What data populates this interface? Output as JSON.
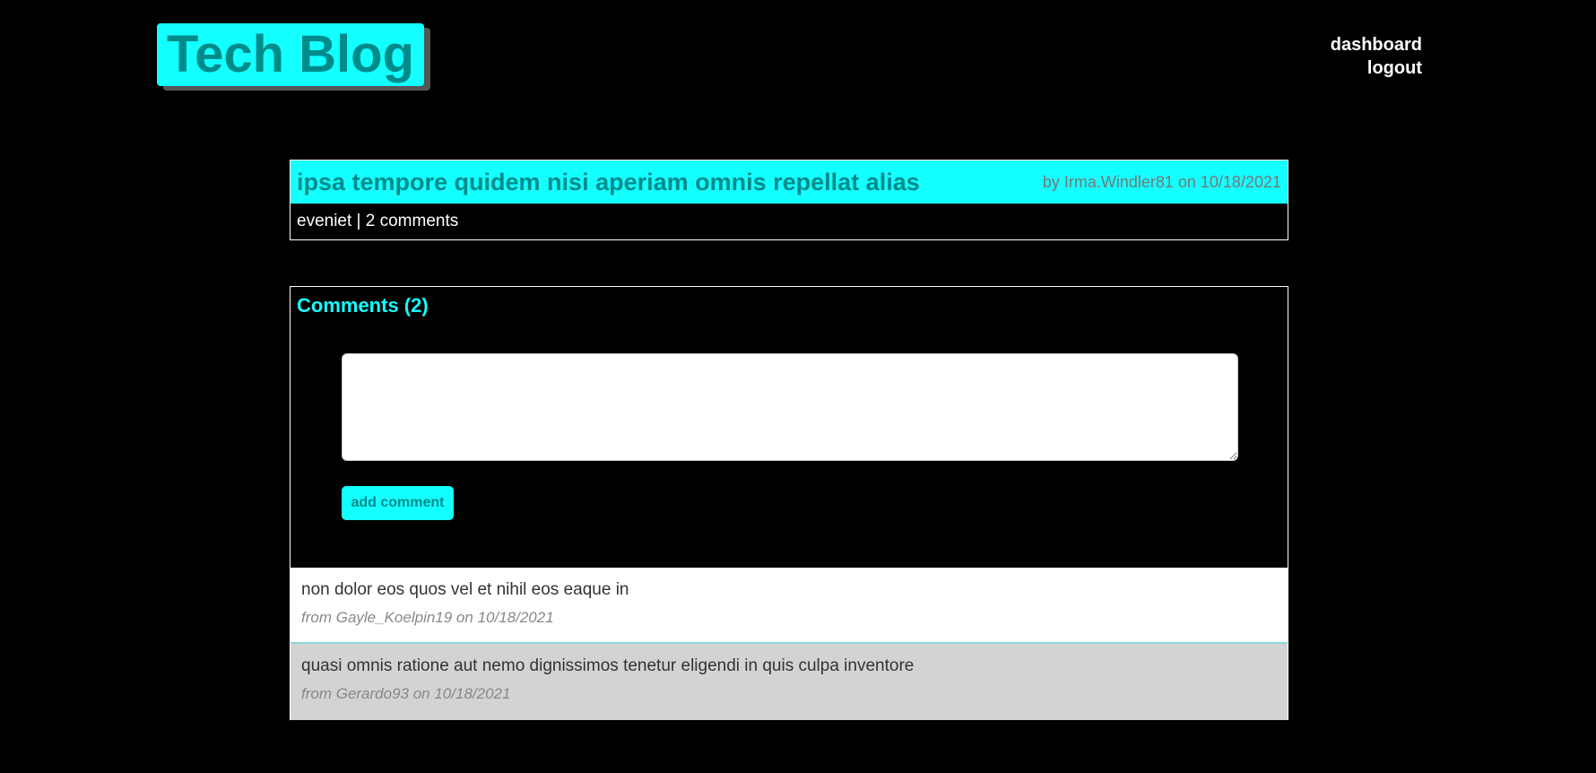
{
  "header": {
    "logo_text": "Tech Blog",
    "nav": {
      "dashboard": "dashboard",
      "logout": "logout"
    }
  },
  "post": {
    "title": "ipsa tempore quidem nisi aperiam omnis repellat alias",
    "meta": "by Irma.Windler81 on 10/18/2021",
    "footer": "eveniet | 2 comments"
  },
  "comments_section": {
    "title": "Comments (2)",
    "input_value": "",
    "add_button_label": "add comment",
    "items": [
      {
        "text": "non dolor eos quos vel et nihil eos eaque in",
        "meta": "from Gayle_Koelpin19 on 10/18/2021"
      },
      {
        "text": "quasi omnis ratione aut nemo dignissimos tenetur eligendi in quis culpa inventore",
        "meta": "from Gerardo93 on 10/18/2021"
      }
    ]
  },
  "colors": {
    "accent": "#14ffff",
    "accent_text": "#008b8b",
    "background": "#000000"
  }
}
